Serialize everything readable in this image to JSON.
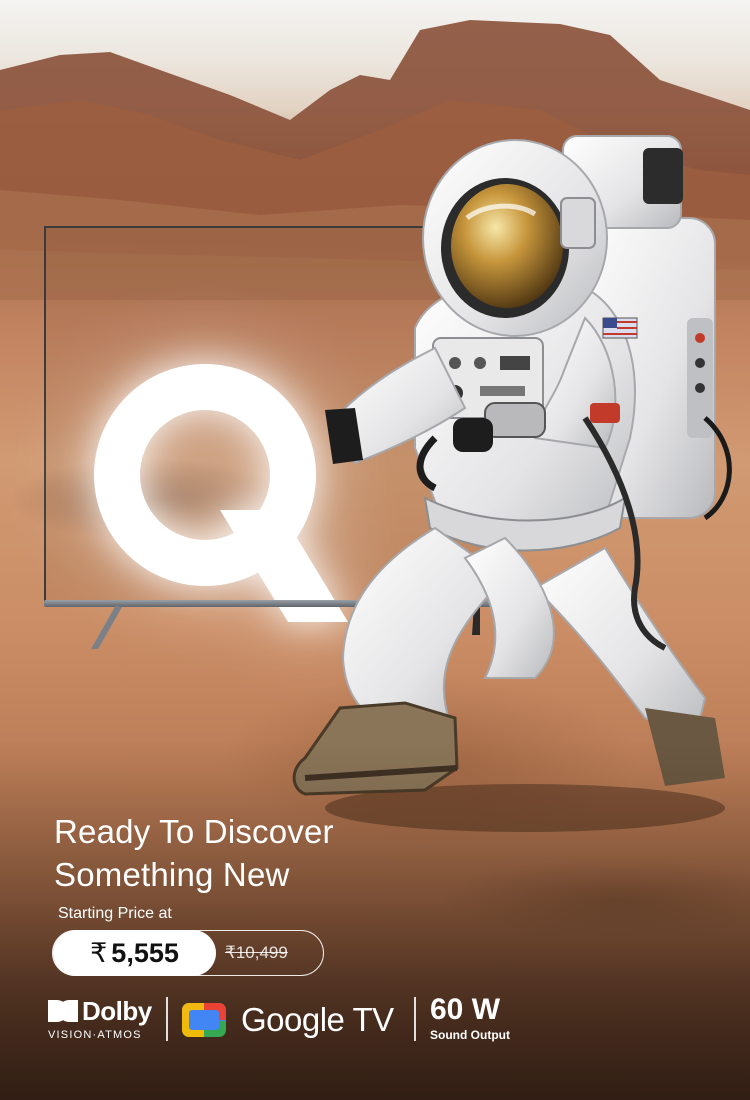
{
  "hero": {
    "headline_line1": "Ready To Discover",
    "headline_line2": "Something New",
    "brand_letter": "Q"
  },
  "pricing": {
    "label": "Starting Price at",
    "currency_symbol": "₹",
    "current_price": "5,555",
    "original_price": "₹10,499"
  },
  "badges": {
    "dolby_word": "Dolby",
    "dolby_sub": "VISION·ATMOS",
    "google_tv": "Google TV",
    "sound_value": "60 W",
    "sound_sub": "Sound Output"
  },
  "icons": [
    "dolby-logo-icon",
    "google-tv-icon",
    "q-brand-logo"
  ],
  "colors": {
    "sand": "#c98a5e",
    "text": "#ffffff",
    "google_blue": "#4285f4",
    "google_red": "#ea4335",
    "google_yellow": "#fbbc04",
    "google_green": "#34a853"
  }
}
